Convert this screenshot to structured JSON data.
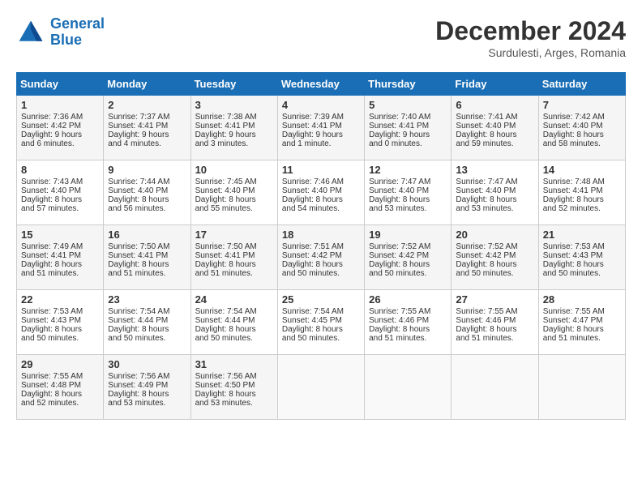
{
  "header": {
    "logo_line1": "General",
    "logo_line2": "Blue",
    "month": "December 2024",
    "location": "Surdulesti, Arges, Romania"
  },
  "days_of_week": [
    "Sunday",
    "Monday",
    "Tuesday",
    "Wednesday",
    "Thursday",
    "Friday",
    "Saturday"
  ],
  "weeks": [
    [
      {
        "day": "1",
        "lines": [
          "Sunrise: 7:36 AM",
          "Sunset: 4:42 PM",
          "Daylight: 9 hours",
          "and 6 minutes."
        ]
      },
      {
        "day": "2",
        "lines": [
          "Sunrise: 7:37 AM",
          "Sunset: 4:41 PM",
          "Daylight: 9 hours",
          "and 4 minutes."
        ]
      },
      {
        "day": "3",
        "lines": [
          "Sunrise: 7:38 AM",
          "Sunset: 4:41 PM",
          "Daylight: 9 hours",
          "and 3 minutes."
        ]
      },
      {
        "day": "4",
        "lines": [
          "Sunrise: 7:39 AM",
          "Sunset: 4:41 PM",
          "Daylight: 9 hours",
          "and 1 minute."
        ]
      },
      {
        "day": "5",
        "lines": [
          "Sunrise: 7:40 AM",
          "Sunset: 4:41 PM",
          "Daylight: 9 hours",
          "and 0 minutes."
        ]
      },
      {
        "day": "6",
        "lines": [
          "Sunrise: 7:41 AM",
          "Sunset: 4:40 PM",
          "Daylight: 8 hours",
          "and 59 minutes."
        ]
      },
      {
        "day": "7",
        "lines": [
          "Sunrise: 7:42 AM",
          "Sunset: 4:40 PM",
          "Daylight: 8 hours",
          "and 58 minutes."
        ]
      }
    ],
    [
      {
        "day": "8",
        "lines": [
          "Sunrise: 7:43 AM",
          "Sunset: 4:40 PM",
          "Daylight: 8 hours",
          "and 57 minutes."
        ]
      },
      {
        "day": "9",
        "lines": [
          "Sunrise: 7:44 AM",
          "Sunset: 4:40 PM",
          "Daylight: 8 hours",
          "and 56 minutes."
        ]
      },
      {
        "day": "10",
        "lines": [
          "Sunrise: 7:45 AM",
          "Sunset: 4:40 PM",
          "Daylight: 8 hours",
          "and 55 minutes."
        ]
      },
      {
        "day": "11",
        "lines": [
          "Sunrise: 7:46 AM",
          "Sunset: 4:40 PM",
          "Daylight: 8 hours",
          "and 54 minutes."
        ]
      },
      {
        "day": "12",
        "lines": [
          "Sunrise: 7:47 AM",
          "Sunset: 4:40 PM",
          "Daylight: 8 hours",
          "and 53 minutes."
        ]
      },
      {
        "day": "13",
        "lines": [
          "Sunrise: 7:47 AM",
          "Sunset: 4:40 PM",
          "Daylight: 8 hours",
          "and 53 minutes."
        ]
      },
      {
        "day": "14",
        "lines": [
          "Sunrise: 7:48 AM",
          "Sunset: 4:41 PM",
          "Daylight: 8 hours",
          "and 52 minutes."
        ]
      }
    ],
    [
      {
        "day": "15",
        "lines": [
          "Sunrise: 7:49 AM",
          "Sunset: 4:41 PM",
          "Daylight: 8 hours",
          "and 51 minutes."
        ]
      },
      {
        "day": "16",
        "lines": [
          "Sunrise: 7:50 AM",
          "Sunset: 4:41 PM",
          "Daylight: 8 hours",
          "and 51 minutes."
        ]
      },
      {
        "day": "17",
        "lines": [
          "Sunrise: 7:50 AM",
          "Sunset: 4:41 PM",
          "Daylight: 8 hours",
          "and 51 minutes."
        ]
      },
      {
        "day": "18",
        "lines": [
          "Sunrise: 7:51 AM",
          "Sunset: 4:42 PM",
          "Daylight: 8 hours",
          "and 50 minutes."
        ]
      },
      {
        "day": "19",
        "lines": [
          "Sunrise: 7:52 AM",
          "Sunset: 4:42 PM",
          "Daylight: 8 hours",
          "and 50 minutes."
        ]
      },
      {
        "day": "20",
        "lines": [
          "Sunrise: 7:52 AM",
          "Sunset: 4:42 PM",
          "Daylight: 8 hours",
          "and 50 minutes."
        ]
      },
      {
        "day": "21",
        "lines": [
          "Sunrise: 7:53 AM",
          "Sunset: 4:43 PM",
          "Daylight: 8 hours",
          "and 50 minutes."
        ]
      }
    ],
    [
      {
        "day": "22",
        "lines": [
          "Sunrise: 7:53 AM",
          "Sunset: 4:43 PM",
          "Daylight: 8 hours",
          "and 50 minutes."
        ]
      },
      {
        "day": "23",
        "lines": [
          "Sunrise: 7:54 AM",
          "Sunset: 4:44 PM",
          "Daylight: 8 hours",
          "and 50 minutes."
        ]
      },
      {
        "day": "24",
        "lines": [
          "Sunrise: 7:54 AM",
          "Sunset: 4:44 PM",
          "Daylight: 8 hours",
          "and 50 minutes."
        ]
      },
      {
        "day": "25",
        "lines": [
          "Sunrise: 7:54 AM",
          "Sunset: 4:45 PM",
          "Daylight: 8 hours",
          "and 50 minutes."
        ]
      },
      {
        "day": "26",
        "lines": [
          "Sunrise: 7:55 AM",
          "Sunset: 4:46 PM",
          "Daylight: 8 hours",
          "and 51 minutes."
        ]
      },
      {
        "day": "27",
        "lines": [
          "Sunrise: 7:55 AM",
          "Sunset: 4:46 PM",
          "Daylight: 8 hours",
          "and 51 minutes."
        ]
      },
      {
        "day": "28",
        "lines": [
          "Sunrise: 7:55 AM",
          "Sunset: 4:47 PM",
          "Daylight: 8 hours",
          "and 51 minutes."
        ]
      }
    ],
    [
      {
        "day": "29",
        "lines": [
          "Sunrise: 7:55 AM",
          "Sunset: 4:48 PM",
          "Daylight: 8 hours",
          "and 52 minutes."
        ]
      },
      {
        "day": "30",
        "lines": [
          "Sunrise: 7:56 AM",
          "Sunset: 4:49 PM",
          "Daylight: 8 hours",
          "and 53 minutes."
        ]
      },
      {
        "day": "31",
        "lines": [
          "Sunrise: 7:56 AM",
          "Sunset: 4:50 PM",
          "Daylight: 8 hours",
          "and 53 minutes."
        ]
      },
      {
        "day": "",
        "lines": []
      },
      {
        "day": "",
        "lines": []
      },
      {
        "day": "",
        "lines": []
      },
      {
        "day": "",
        "lines": []
      }
    ]
  ]
}
